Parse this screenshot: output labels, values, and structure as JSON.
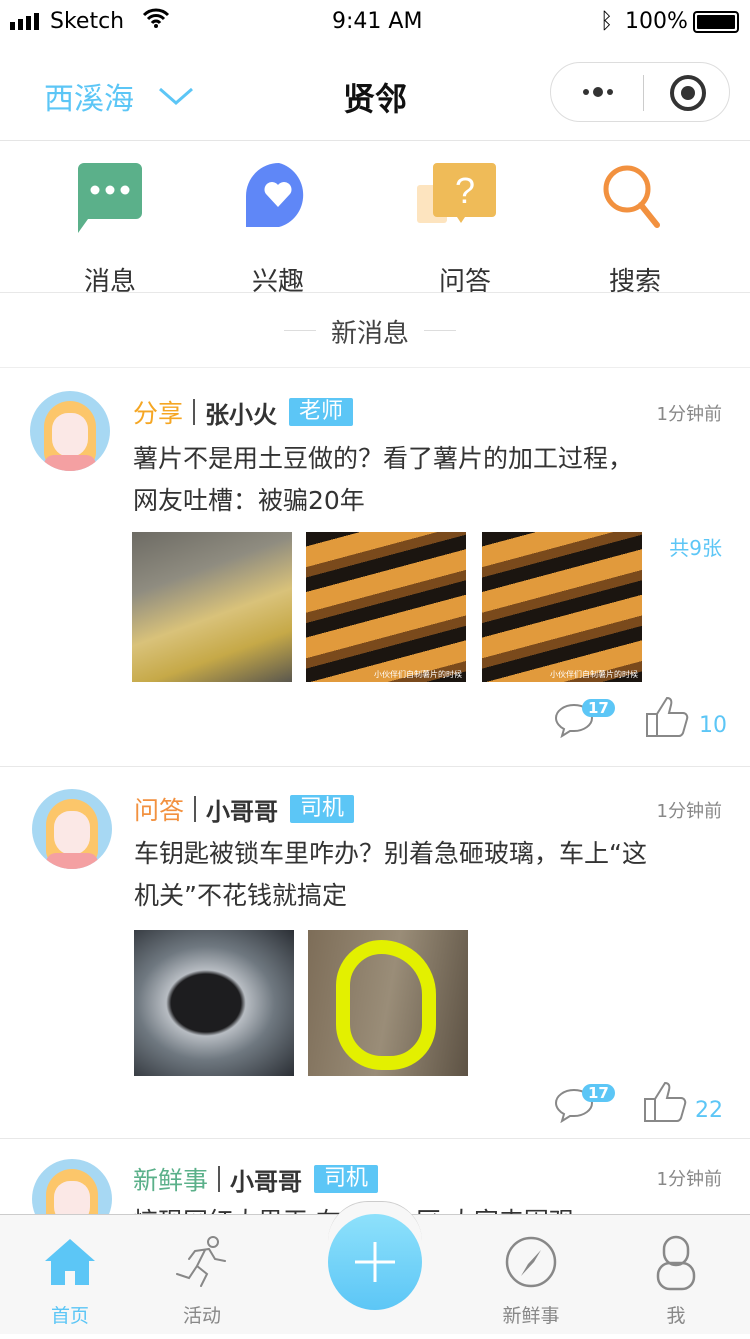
{
  "status_bar": {
    "carrier": "Sketch",
    "time": "9:41 AM",
    "battery": "100%"
  },
  "nav": {
    "location": "西溪海",
    "title": "贤邻"
  },
  "quick_menu": [
    {
      "label": "消息",
      "icon": "chat-bubble-icon",
      "color": "#5bb08a"
    },
    {
      "label": "兴趣",
      "icon": "heart-bubble-icon",
      "color": "#5f87f7"
    },
    {
      "label": "问答",
      "icon": "question-bubble-icon",
      "color": "#efbb58"
    },
    {
      "label": "搜索",
      "icon": "search-icon",
      "color": "#f2913f"
    }
  ],
  "section_title": "新消息",
  "posts": [
    {
      "category": "分享",
      "category_color": "#f5a623",
      "user": "张小火",
      "tag": "老师",
      "time": "1分钟前",
      "text": "薯片不是用土豆做的？看了薯片的加工过程，网友吐槽：被骗20年",
      "image_count": "共9张",
      "comments": "17",
      "likes": "10",
      "image_captions": [
        "",
        "小伙伴们自制薯片的时候",
        "小伙伴们自制薯片的时候"
      ]
    },
    {
      "category": "问答",
      "category_color": "#f2913f",
      "user": "小哥哥",
      "tag": "司机",
      "time": "1分钟前",
      "text": "车钥匙被锁车里咋办？别着急砸玻璃，车上“这机关”不花钱就搞定",
      "comments": "17",
      "likes": "22"
    },
    {
      "category": "新鲜事",
      "category_color": "#5bb08a",
      "user": "小哥哥",
      "tag": "司机",
      "time": "1分钟前",
      "text": "惊现网红大男王 在我们小区 大家来围观"
    }
  ],
  "tabbar": {
    "items": [
      {
        "label": "首页",
        "icon": "home-icon",
        "active": true
      },
      {
        "label": "活动",
        "icon": "running-icon"
      },
      {
        "label": "",
        "icon": "plus-icon"
      },
      {
        "label": "新鲜事",
        "icon": "compass-icon"
      },
      {
        "label": "我",
        "icon": "user-icon"
      }
    ]
  },
  "colors": {
    "accent": "#5cc6f6"
  }
}
